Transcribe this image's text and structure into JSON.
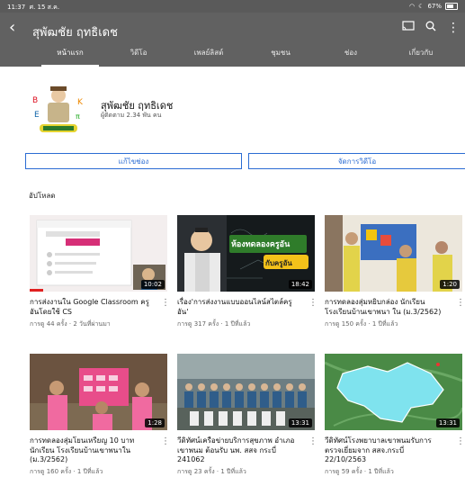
{
  "status": {
    "time": "11:37",
    "date": "ศ. 15 ส.ค.",
    "battery": "67%",
    "battery_fill": 0.67
  },
  "appbar": {
    "title": "สุพัฒชัย ฤทธิเดช"
  },
  "tabs": [
    "หน้าแรก",
    "วิดีโอ",
    "เพลย์ลิสต์",
    "ชุมชน",
    "ช่อง",
    "เกี่ยวกับ"
  ],
  "channel": {
    "name": "สุพัฒชัย ฤทธิเดช",
    "subscribers": "ผู้ติดตาม 2.34 พัน คน"
  },
  "buttons": {
    "edit": "แก้ไขช่อง",
    "manage": "จัดการวิดีโอ"
  },
  "section_title": "อัปโหลด",
  "videos": [
    {
      "title": "การส่งงานใน Google Classroom ครูอันโดยใช้ CS",
      "meta": "การดู 44 ครั้ง · 2 วันที่ผ่านมา",
      "duration": "10:02",
      "progress": 0.1
    },
    {
      "title": "เรื่อง'การส่งงานแบบออนไลน์สไตล์ครูอัน'",
      "meta": "การดู 317 ครั้ง · 1 ปีที่แล้ว",
      "duration": "18:42",
      "thumb_text": "ห้องทดลองครูอัน",
      "thumb_badge": "กับครูอัน"
    },
    {
      "title": "การทดลองสุ่มหยิบกล่อง นักเรียนโรงเรียนบ้านเขาพนา ใน (ม.3/2562)",
      "meta": "การดู 150 ครั้ง · 1 ปีที่แล้ว",
      "duration": "1:20"
    },
    {
      "title": "การทดลองสุ่มโยนเหรียญ 10 บาท นักเรียน โรงเรียนบ้านเขาพนาใน (ม.3/2562)",
      "meta": "การดู 160 ครั้ง · 1 ปีที่แล้ว",
      "duration": "1:28"
    },
    {
      "title": "วีดิทัศน์เครือข่ายบริการสุขภาพ อำเภอเขาพนม ต้อนรับ นพ. สสจ กระบี่ 241062",
      "meta": "การดู 23 ครั้ง · 1 ปีที่แล้ว",
      "duration": "13:31"
    },
    {
      "title": "วีดิทัศน์โรงพยาบาลเขาพนมรับการตรวจเยี่ยมจาก สสจ.กระบี่ 22/10/2563",
      "meta": "การดู 59 ครั้ง · 1 ปีที่แล้ว",
      "duration": "13:31"
    }
  ],
  "colors": {
    "appbar": "#616161",
    "accent": "#2b6cd3",
    "progress": "#e02020"
  }
}
